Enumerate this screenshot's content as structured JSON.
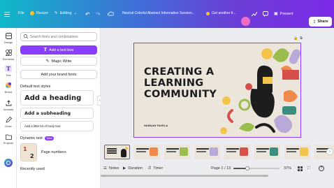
{
  "topbar": {
    "file": "File",
    "resize": "Resize",
    "mode": "Editing",
    "doc_title": "Neutral Colorful Abstract Information Session...",
    "get_another": "Get another fr...",
    "present": "Present",
    "share": "Share"
  },
  "rail": {
    "items": [
      {
        "label": "Design",
        "icon": "design-icon"
      },
      {
        "label": "Elements",
        "icon": "elements-icon"
      },
      {
        "label": "Text",
        "icon": "text-icon"
      },
      {
        "label": "Brand",
        "icon": "brand-icon"
      },
      {
        "label": "Uploads",
        "icon": "uploads-icon"
      },
      {
        "label": "Draw",
        "icon": "draw-icon"
      },
      {
        "label": "Projects",
        "icon": "projects-icon"
      }
    ]
  },
  "panel": {
    "search_placeholder": "Search fonts and combinations",
    "add_text_box": "Add a text box",
    "magic_write": "Magic Write",
    "brand_fonts": "Add your brand fonts",
    "default_text_styles": "Default text styles",
    "heading": "Add a heading",
    "subheading": "Add a subheading",
    "body": "Add a little bit of body text",
    "dynamic_text": "Dynamic text",
    "new_badge": "New",
    "page_numbers": "Page numbers",
    "page_numbers_thumb": "1",
    "page_numbers_thumb2": "2",
    "recently_used": "Recently used"
  },
  "slide": {
    "title_line1": "CREATING A",
    "title_line2": "LEARNING",
    "title_line3": "COMMUNITY",
    "author": "HANNAH FAVELA"
  },
  "bottom": {
    "notes": "Notes",
    "duration": "Duration",
    "timer": "Timer",
    "page": "Page 1 / 13",
    "zoom": "37%"
  },
  "colors": {
    "accent": "#8b3dff",
    "brand_purple": "#7d2ae8",
    "slide_bg": "#ece5dc"
  }
}
